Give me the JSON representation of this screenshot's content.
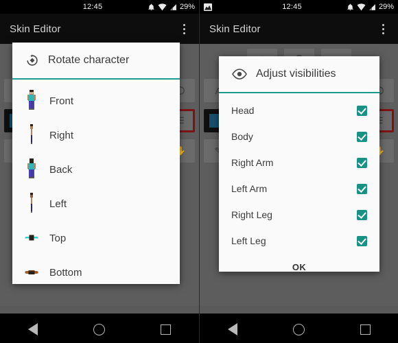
{
  "screens": [
    {
      "id": "rotate-screen",
      "statusbar": {
        "time": "12:45",
        "battery": "29%",
        "icons": [
          "bell-icon",
          "wifi-icon",
          "signal-icon"
        ],
        "left_icons": []
      },
      "appbar": {
        "title": "Skin Editor",
        "overflow": "overflow-menu-icon"
      },
      "dialog": {
        "icon": "rotate-character-icon",
        "title": "Rotate character",
        "items": [
          {
            "label": "Front",
            "icon": "character-front-icon"
          },
          {
            "label": "Right",
            "icon": "character-right-icon"
          },
          {
            "label": "Back",
            "icon": "character-back-icon"
          },
          {
            "label": "Left",
            "icon": "character-left-icon"
          },
          {
            "label": "Top",
            "icon": "character-top-icon"
          },
          {
            "label": "Bottom",
            "icon": "character-bottom-icon"
          }
        ]
      }
    },
    {
      "id": "visibilities-screen",
      "statusbar": {
        "time": "12:45",
        "battery": "29%",
        "icons": [
          "bell-icon",
          "wifi-icon",
          "signal-icon"
        ],
        "left_icons": [
          "screenshot-image-icon"
        ]
      },
      "appbar": {
        "title": "Skin Editor",
        "overflow": "overflow-menu-icon"
      },
      "dialog": {
        "icon": "eye-icon",
        "title": "Adjust visibilities",
        "items": [
          {
            "label": "Head",
            "checked": true
          },
          {
            "label": "Body",
            "checked": true
          },
          {
            "label": "Right Arm",
            "checked": true
          },
          {
            "label": "Left Arm",
            "checked": true
          },
          {
            "label": "Right Leg",
            "checked": true
          },
          {
            "label": "Left Leg",
            "checked": true
          }
        ],
        "ok_label": "OK"
      }
    }
  ],
  "navbar": {
    "back": "back-triangle-icon",
    "home": "home-circle-icon",
    "recent": "recents-square-icon"
  },
  "colors": {
    "accent": "#189187",
    "divider": "#1c9b90",
    "statusbar_bg": "#000000",
    "appbar_bg": "#0d0d0d",
    "dialog_bg": "#fafafa",
    "app_bg": "#5d5d5d",
    "selected_swatch_blue": "#17506e",
    "selected_swatch_border_red": "#7c1414",
    "text_primary": "#3b3b3b",
    "appbar_title": "#d4d4d4"
  }
}
